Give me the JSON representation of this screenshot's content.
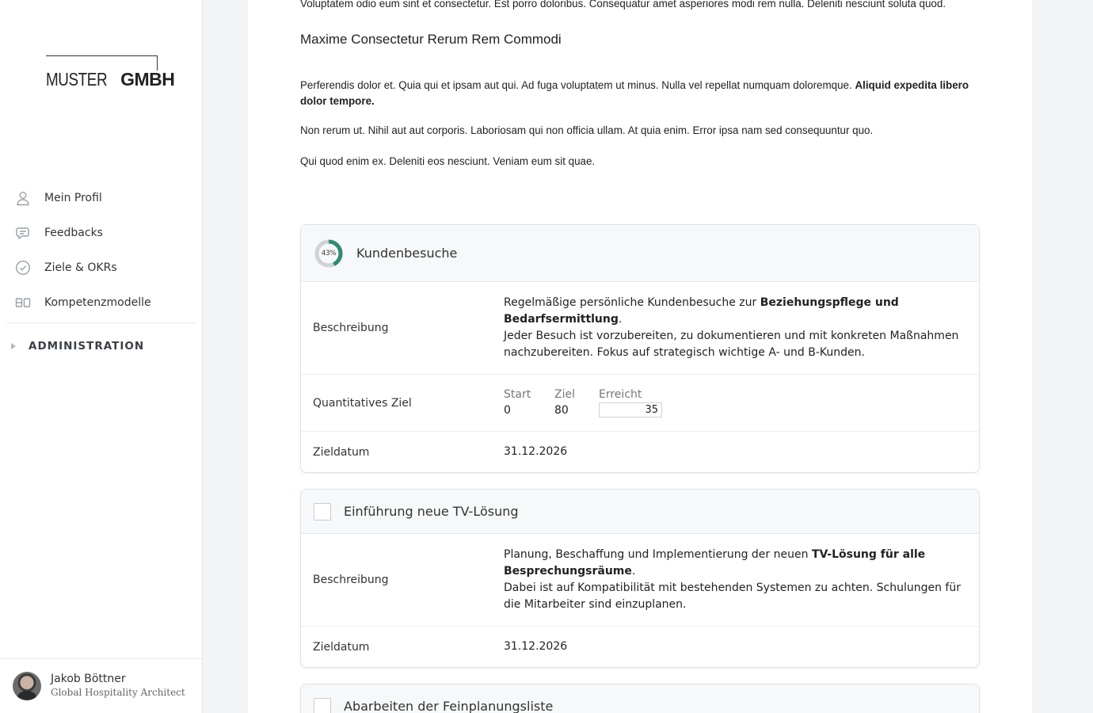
{
  "brand": {
    "logo_thin": "MUSTER",
    "logo_bold": "GMBH"
  },
  "nav": {
    "items": [
      {
        "label": "Mein Profil",
        "icon": "user-icon"
      },
      {
        "label": "Feedbacks",
        "icon": "chat-icon"
      },
      {
        "label": "Ziele & OKRs",
        "icon": "check-circle-icon"
      },
      {
        "label": "Kompetenzmodelle",
        "icon": "blocks-icon"
      }
    ],
    "admin_label": "ADMINISTRATION"
  },
  "user": {
    "name": "Jakob Böttner",
    "role": "Global Hospitality Architect"
  },
  "prose": {
    "p0": "Voluptatem odio eum sint et consectetur. Est porro doloribus. Consequatur amet asperiores modi rem nulla. Deleniti nesciunt soluta quod.",
    "heading": "Maxime Consectetur Rerum Rem Commodi",
    "p1": "Perferendis dolor et. Quia qui et ipsam aut qui. Ad fuga voluptatem ut minus. Nulla vel repellat numquam doloremque.",
    "p1_bold": "Aliquid expedita libero dolor tempore.",
    "p2": "Non rerum ut. Nihil aut aut corporis. Laboriosam qui non officia ullam. At quia enim. Error ipsa nam sed consequuntur quo.",
    "p3": "Qui quod enim ex. Deleniti eos nesciunt. Veniam eum sit quae."
  },
  "goals": [
    {
      "title": "Kundenbesuche",
      "progress_label": "43%",
      "progress": 0.43,
      "desc_label": "Beschreibung",
      "desc_a": "Regelmäßige persönliche Kundenbesuche zur ",
      "desc_bold": "Beziehungspflege und Bedarfsermittlung",
      "desc_b": ".",
      "desc_c": "Jeder Besuch ist vorzubereiten, zu dokumentieren und mit konkreten Maßnahmen nachzubereiten. Fokus auf strategisch wichtige A- und B-Kunden.",
      "quant_label": "Quantitatives Ziel",
      "start_label": "Start",
      "start": "0",
      "ziel_label": "Ziel",
      "ziel": "80",
      "erreicht_label": "Erreicht",
      "erreicht": "35",
      "date_label": "Zieldatum",
      "date": "31.12.2026"
    },
    {
      "title": "Einführung neue TV-Lösung",
      "desc_label": "Beschreibung",
      "desc_a": "Planung, Beschaffung und Implementierung der neuen ",
      "desc_bold": "TV-Lösung für alle Besprechungsräume",
      "desc_b": ".",
      "desc_c": "Dabei ist auf Kompatibilität mit bestehenden Systemen zu achten. Schulungen für die Mitarbeiter sind einzuplanen.",
      "date_label": "Zieldatum",
      "date": "31.12.2026"
    },
    {
      "title": "Abarbeiten der Feinplanungsliste"
    }
  ],
  "colors": {
    "accent": "#2e8b72",
    "ring_bg": "#cfd3d6"
  }
}
